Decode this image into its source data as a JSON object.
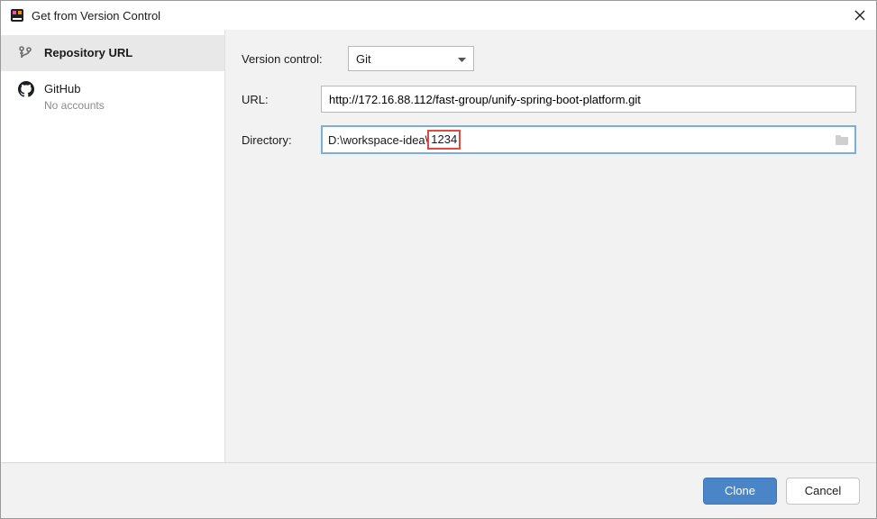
{
  "window": {
    "title": "Get from Version Control"
  },
  "sidebar": {
    "items": [
      {
        "label": "Repository URL",
        "sublabel": ""
      },
      {
        "label": "GitHub",
        "sublabel": "No accounts"
      }
    ]
  },
  "form": {
    "version_control_label": "Version control:",
    "version_control_value": "Git",
    "url_label": "URL:",
    "url_value": "http://172.16.88.112/fast-group/unify-spring-boot-platform.git",
    "directory_label": "Directory:",
    "directory_prefix": "D:\\workspace-idea\\",
    "directory_highlight": "1234"
  },
  "footer": {
    "clone_label": "Clone",
    "cancel_label": "Cancel"
  }
}
